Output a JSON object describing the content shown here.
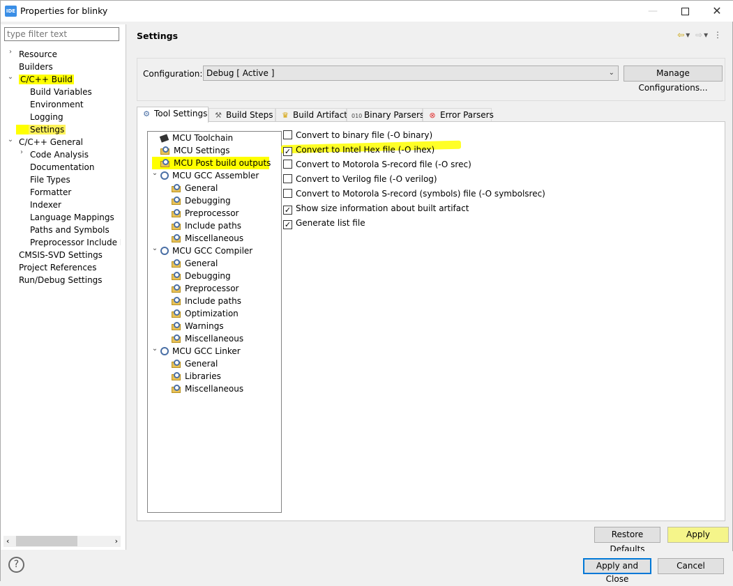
{
  "window": {
    "title": "Properties for blinky",
    "app_icon": "IDE"
  },
  "left": {
    "filter_placeholder": "type filter text",
    "tree": [
      {
        "label": "Resource",
        "twisty": ">"
      },
      {
        "label": "Builders"
      },
      {
        "label": "C/C++ Build",
        "twisty": "v"
      },
      {
        "label": "Build Variables"
      },
      {
        "label": "Environment"
      },
      {
        "label": "Logging"
      },
      {
        "label": "Settings"
      },
      {
        "label": "C/C++ General",
        "twisty": "v"
      },
      {
        "label": "Code Analysis",
        "twisty": ">"
      },
      {
        "label": "Documentation"
      },
      {
        "label": "File Types"
      },
      {
        "label": "Formatter"
      },
      {
        "label": "Indexer"
      },
      {
        "label": "Language Mappings"
      },
      {
        "label": "Paths and Symbols"
      },
      {
        "label": "Preprocessor Include Pa"
      },
      {
        "label": "CMSIS-SVD Settings"
      },
      {
        "label": "Project References"
      },
      {
        "label": "Run/Debug Settings"
      }
    ]
  },
  "main": {
    "title": "Settings",
    "configuration_label": "Configuration:",
    "configuration_value": "Debug  [ Active ]",
    "manage_button": "Manage Configurations...",
    "tabs": [
      {
        "label": "Tool Settings",
        "icon": "tool-settings-icon"
      },
      {
        "label": "Build Steps",
        "icon": "build-steps-icon"
      },
      {
        "label": "Build Artifact",
        "icon": "trophy-icon"
      },
      {
        "label": "Binary Parsers",
        "icon": "binary-icon"
      },
      {
        "label": "Error Parsers",
        "icon": "error-icon"
      }
    ],
    "tool_tree": [
      "MCU Toolchain",
      "MCU Settings",
      "MCU Post build outputs",
      "MCU GCC Assembler",
      "General",
      "Debugging",
      "Preprocessor",
      "Include paths",
      "Miscellaneous",
      "MCU GCC Compiler",
      "General",
      "Debugging",
      "Preprocessor",
      "Include paths",
      "Optimization",
      "Warnings",
      "Miscellaneous",
      "MCU GCC Linker",
      "General",
      "Libraries",
      "Miscellaneous"
    ],
    "options": [
      {
        "label": "Convert to binary file (-O binary)",
        "checked": false
      },
      {
        "label": "Convert to Intel Hex file (-O ihex)",
        "checked": true
      },
      {
        "label": "Convert to Motorola S-record file (-O srec)",
        "checked": false
      },
      {
        "label": "Convert to Verilog file (-O verilog)",
        "checked": false
      },
      {
        "label": "Convert to Motorola S-record (symbols) file (-O symbolsrec)",
        "checked": false
      },
      {
        "label": "Show size information about built artifact",
        "checked": true
      },
      {
        "label": "Generate list file",
        "checked": true
      }
    ],
    "restore_defaults": "Restore Defaults",
    "apply": "Apply"
  },
  "footer": {
    "apply_close": "Apply and Close",
    "cancel": "Cancel"
  },
  "colors": {
    "highlight": "#ffff00",
    "accent": "#0078d7"
  }
}
